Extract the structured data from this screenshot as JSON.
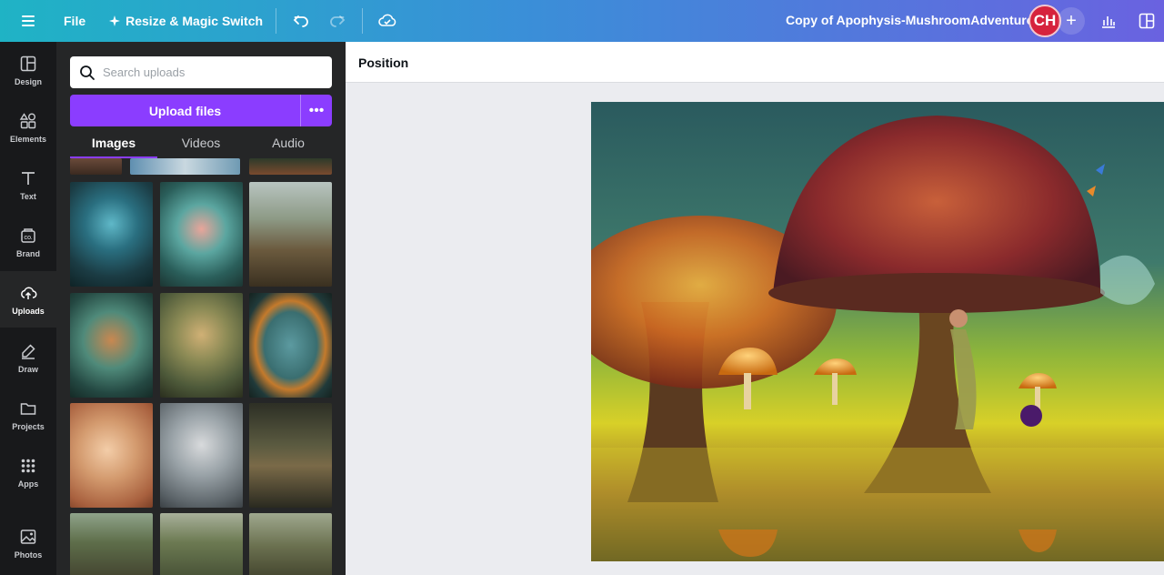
{
  "topbar": {
    "file_label": "File",
    "resize_label": "Resize & Magic Switch",
    "doc_title": "Copy of Apophysis-MushroomAdventure",
    "avatar_initials": "CH",
    "add_label": "+"
  },
  "rail": {
    "items": [
      {
        "label": "Design"
      },
      {
        "label": "Elements"
      },
      {
        "label": "Text"
      },
      {
        "label": "Brand"
      },
      {
        "label": "Uploads"
      },
      {
        "label": "Draw"
      },
      {
        "label": "Projects"
      },
      {
        "label": "Apps"
      },
      {
        "label": "Photos"
      }
    ],
    "active": "Uploads"
  },
  "panel": {
    "search_placeholder": "Search uploads",
    "upload_label": "Upload files",
    "tabs": [
      {
        "label": "Images"
      },
      {
        "label": "Videos"
      },
      {
        "label": "Audio"
      }
    ],
    "active_tab": "Images"
  },
  "context_toolbar": {
    "position_label": "Position"
  },
  "colors": {
    "accent": "#8b3dff",
    "rail_bg": "#18191b",
    "panel_bg": "#252627",
    "avatar": "#d6233d"
  }
}
